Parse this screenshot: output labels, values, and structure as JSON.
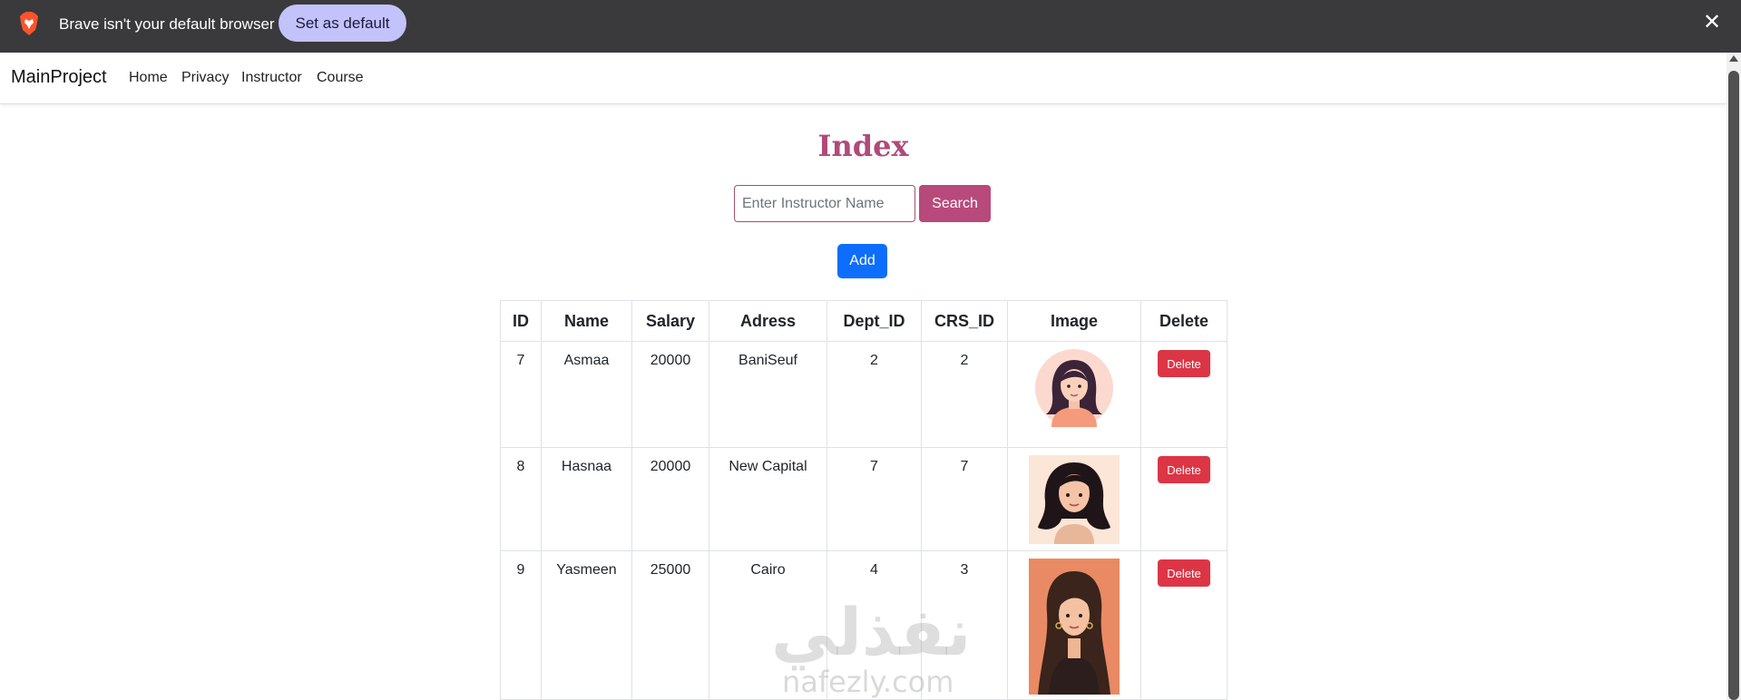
{
  "infobar": {
    "message": "Brave isn't your default browser",
    "set_default_label": "Set as default",
    "close_icon": "close-icon"
  },
  "nav": {
    "brand": "MainProject",
    "links": [
      "Home",
      "Privacy",
      "Instructor",
      "Course"
    ]
  },
  "main": {
    "title": "Index",
    "search_placeholder": "Enter Instructor Name",
    "search_label": "Search",
    "add_label": "Add"
  },
  "table": {
    "headers": [
      "ID",
      "Name",
      "Salary",
      "Adress",
      "Dept_ID",
      "CRS_ID",
      "Image",
      "Delete"
    ],
    "rows": [
      {
        "id": "7",
        "name": "Asmaa",
        "salary": "20000",
        "address": "BaniSeuf",
        "dept_id": "2",
        "crs_id": "2",
        "delete_label": "Delete"
      },
      {
        "id": "8",
        "name": "Hasnaa",
        "salary": "20000",
        "address": "New Capital",
        "dept_id": "7",
        "crs_id": "7",
        "delete_label": "Delete"
      },
      {
        "id": "9",
        "name": "Yasmeen",
        "salary": "25000",
        "address": "Cairo",
        "dept_id": "4",
        "crs_id": "3",
        "delete_label": "Delete"
      }
    ]
  },
  "watermark": {
    "arabic": "نفذلي",
    "latin": "nafezly.com"
  },
  "colors": {
    "infobar_bg": "#3a3a3c",
    "set_default_bg": "#c4c2fb",
    "title": "#b04a7a",
    "search_button": "#b84a7b",
    "add_button": "#0d6efd",
    "delete_button": "#dc3545"
  }
}
